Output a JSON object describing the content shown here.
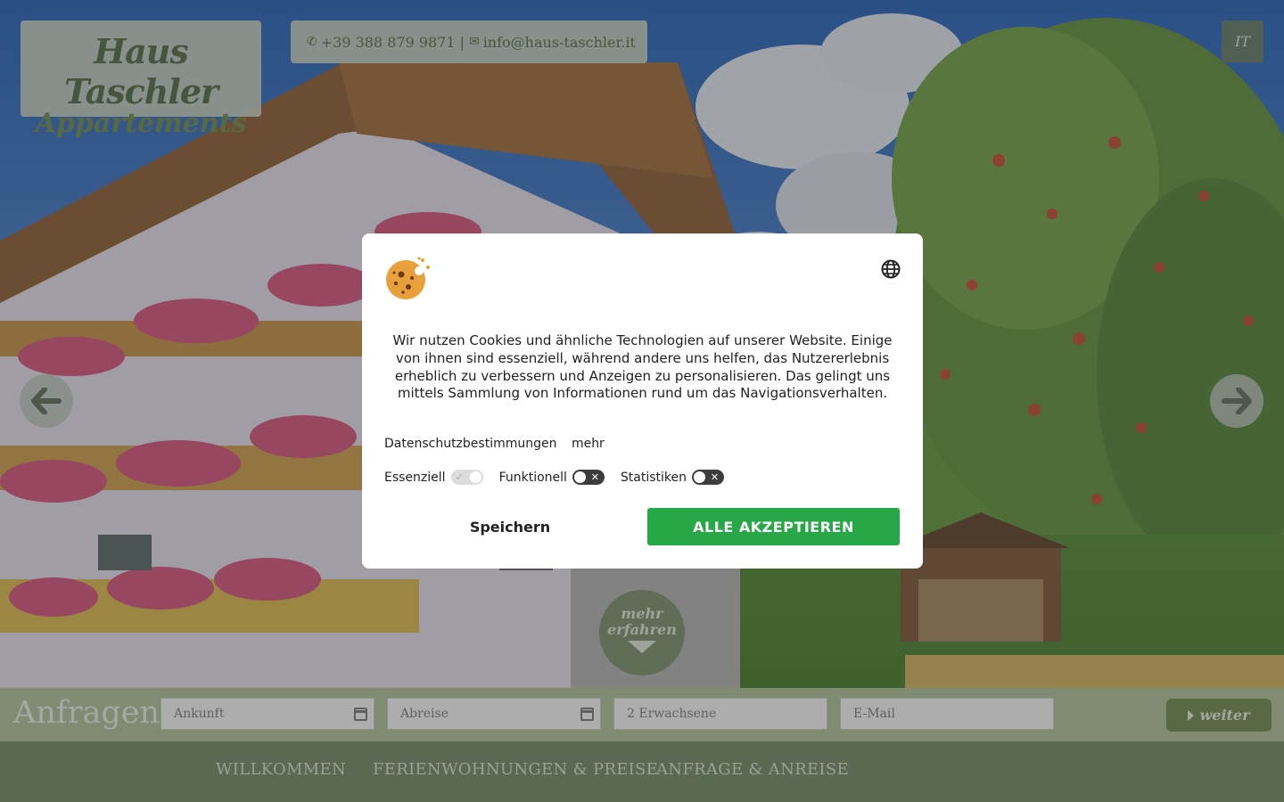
{
  "logo": {
    "line1": "Haus Taschler",
    "line2": "Appartements"
  },
  "contact": {
    "phone": "+39 388 879 9871",
    "separator": "|",
    "email": "info@haus-taschler.it"
  },
  "language_switch": "IT",
  "mehr_erfahren": {
    "line1": "mehr",
    "line2": "erfahren"
  },
  "inquiry": {
    "title": "Anfragen:",
    "fields": {
      "arrival_placeholder": "Ankunft",
      "departure_placeholder": "Abreise",
      "guests_value": "2 Erwachsene",
      "email_placeholder": "E-Mail"
    },
    "submit_label": "weiter"
  },
  "nav": {
    "items": [
      {
        "label": "WILLKOMMEN"
      },
      {
        "label": "FERIENWOHNUNGEN & PREISE"
      },
      {
        "label": "ANFRAGE & ANREISE"
      }
    ]
  },
  "cookie_modal": {
    "text": "Wir nutzen Cookies und ähnliche Technologien auf unserer Website. Einige von ihnen sind essenziell, während andere uns helfen, das Nutzererlebnis erheblich zu verbessern und Anzeigen zu personalisieren. Das gelingt uns mittels Sammlung von Informationen rund um das Navigationsverhalten.",
    "links": {
      "privacy": "Datenschutzbestimmungen",
      "more": "mehr"
    },
    "toggles": [
      {
        "label": "Essenziell",
        "state": "on-locked"
      },
      {
        "label": "Funktionell",
        "state": "off"
      },
      {
        "label": "Statistiken",
        "state": "off"
      }
    ],
    "save_label": "Speichern",
    "accept_all_label": "ALLE AKZEPTIEREN",
    "accent_color": "#26a846"
  },
  "colors": {
    "brand_green": "#6e8a62",
    "inquiry_bar": "#b1c49a"
  }
}
